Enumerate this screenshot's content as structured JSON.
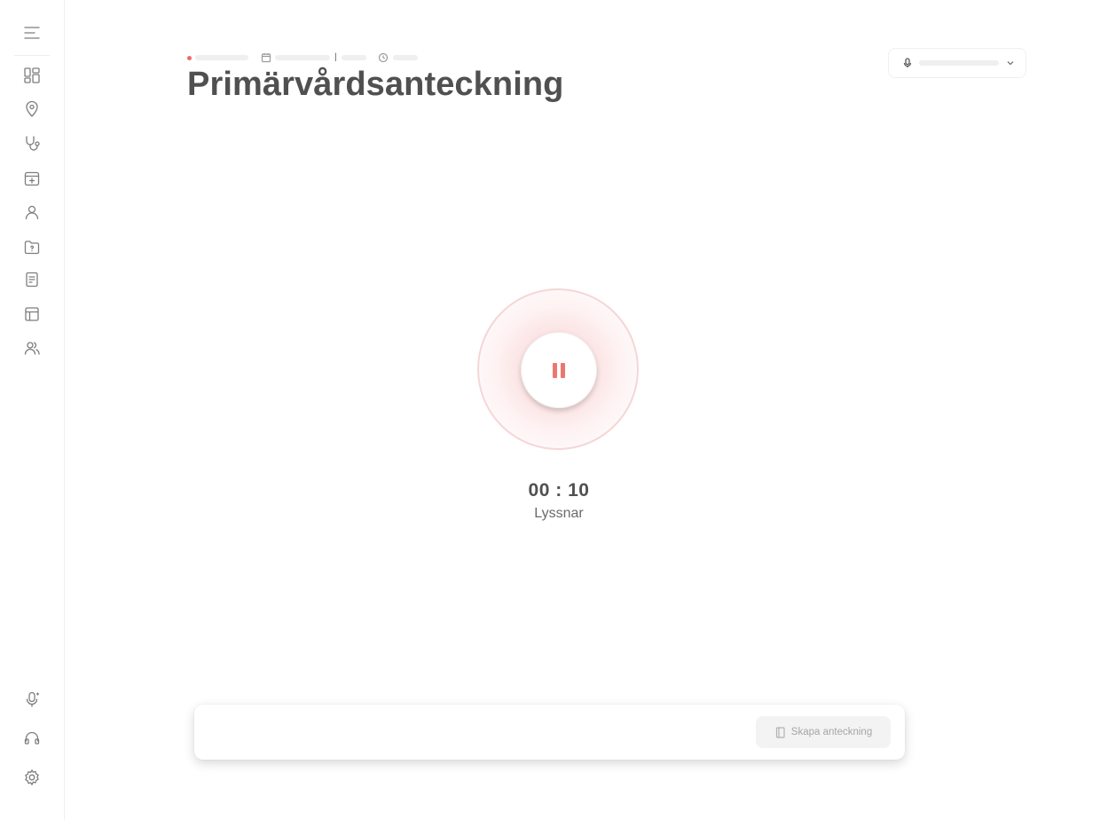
{
  "sidebar": {
    "top_icons": [
      "menu-icon"
    ],
    "nav_items": [
      {
        "icon": "dashboard-icon"
      },
      {
        "icon": "location-pin-icon"
      },
      {
        "icon": "stethoscope-icon"
      },
      {
        "icon": "calendar-add-icon"
      },
      {
        "icon": "user-icon"
      },
      {
        "icon": "folder-question-icon"
      },
      {
        "icon": "document-icon"
      },
      {
        "icon": "table-layout-icon"
      },
      {
        "icon": "users-icon"
      }
    ],
    "bottom_items": [
      {
        "icon": "microphone-settings-icon"
      },
      {
        "icon": "headset-icon"
      },
      {
        "icon": "gear-icon"
      }
    ]
  },
  "header": {
    "meta_separator": "|",
    "title": "Primärvårdsanteckning",
    "status_dot_color": "#ec6b6b"
  },
  "mic_selector": {
    "icon": "microphone-icon"
  },
  "recorder": {
    "timer": "00 : 10",
    "status": "Lyssnar",
    "accent_color": "#e9786f"
  },
  "bottom_bar": {
    "create_button_label": "Skapa anteckning",
    "create_button_icon": "notebook-icon"
  }
}
